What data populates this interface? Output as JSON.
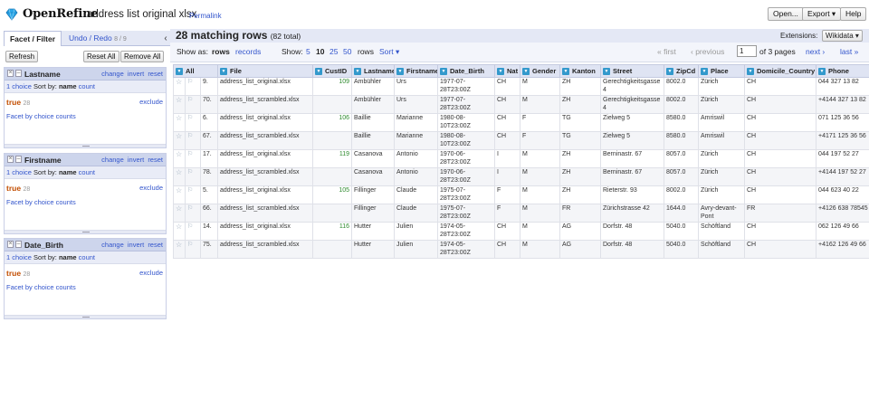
{
  "header": {
    "brand": "OpenRefine",
    "project_name": "address list original xlsx",
    "permalink": "Permalink",
    "open_label": "Open...",
    "export_label": "Export ▾",
    "help_label": "Help"
  },
  "left": {
    "tab_facet": "Facet / Filter",
    "tab_undo": "Undo / Redo",
    "undo_count": "8 / 9",
    "refresh": "Refresh",
    "reset_all": "Reset All",
    "remove_all": "Remove All",
    "facets": [
      {
        "name": "Lastname",
        "change": "change",
        "invert": "invert",
        "reset": "reset",
        "choices": "1 choice",
        "sort_by": "Sort by:",
        "sort_name": "name",
        "sort_count": "count",
        "value": "true",
        "count": "28",
        "exclude": "exclude",
        "by_counts": "Facet by choice counts"
      },
      {
        "name": "Firstname",
        "change": "change",
        "invert": "invert",
        "reset": "reset",
        "choices": "1 choice",
        "sort_by": "Sort by:",
        "sort_name": "name",
        "sort_count": "count",
        "value": "true",
        "count": "28",
        "exclude": "exclude",
        "by_counts": "Facet by choice counts"
      },
      {
        "name": "Date_Birth",
        "change": "change",
        "invert": "invert",
        "reset": "reset",
        "choices": "1 choice",
        "sort_by": "Sort by:",
        "sort_name": "name",
        "sort_count": "count",
        "value": "true",
        "count": "28",
        "exclude": "exclude",
        "by_counts": "Facet by choice counts"
      }
    ]
  },
  "summary": {
    "matching": "28 matching rows",
    "total": "(82 total)",
    "extensions_label": "Extensions:",
    "wikidata": "Wikidata ▾"
  },
  "viewbar": {
    "show_as": "Show as:",
    "rows": "rows",
    "records": "records",
    "show": "Show:",
    "n5": "5",
    "n10": "10",
    "n25": "25",
    "n50": "50",
    "rows2": "rows",
    "sort": "Sort ▾",
    "first": "« first",
    "previous": "‹ previous",
    "page": "1",
    "of_pages": "of 3 pages",
    "next": "next ›",
    "last": "last »"
  },
  "table": {
    "columns": [
      "All",
      "File",
      "CustID",
      "Lastname",
      "Firstname",
      "Date_Birth",
      "Nat",
      "Gender",
      "Kanton",
      "Street",
      "ZipCd",
      "Place",
      "Domicile_Country",
      "Phone"
    ],
    "rows": [
      [
        "9.",
        "address_list_original.xlsx",
        "109",
        "Ambühler",
        "Urs",
        "1977-07-28T23:00Z",
        "CH",
        "M",
        "ZH",
        "Gerechtigkeitsgasse 4",
        "8002.0",
        "Zürich",
        "CH",
        "044 327 13 82"
      ],
      [
        "70.",
        "address_list_scrambled.xlsx",
        "",
        "Ambühler",
        "Urs",
        "1977-07-28T23:00Z",
        "CH",
        "M",
        "ZH",
        "Gerechtigkeitsgasse 4",
        "8002.0",
        "Zürich",
        "CH",
        "+4144 327 13 82"
      ],
      [
        "6.",
        "address_list_original.xlsx",
        "106",
        "Baillie",
        "Marianne",
        "1980-08-10T23:00Z",
        "CH",
        "F",
        "TG",
        "Zielweg 5",
        "8580.0",
        "Amriswil",
        "CH",
        "071 125 36 56"
      ],
      [
        "67.",
        "address_list_scrambled.xlsx",
        "",
        "Baillie",
        "Marianne",
        "1980-08-10T23:00Z",
        "CH",
        "F",
        "TG",
        "Zielweg 5",
        "8580.0",
        "Amriswil",
        "CH",
        "+4171 125 36 56"
      ],
      [
        "17.",
        "address_list_original.xlsx",
        "119",
        "Casanova",
        "Antonio",
        "1970-06-28T23:00Z",
        "I",
        "M",
        "ZH",
        "Berninastr. 67",
        "8057.0",
        "Zürich",
        "CH",
        "044 197 52 27"
      ],
      [
        "78.",
        "address_list_scrambled.xlsx",
        "",
        "Casanova",
        "Antonio",
        "1970-06-28T23:00Z",
        "I",
        "M",
        "ZH",
        "Berninastr. 67",
        "8057.0",
        "Zürich",
        "CH",
        "+4144 197 52 27"
      ],
      [
        "5.",
        "address_list_original.xlsx",
        "105",
        "Fillinger",
        "Claude",
        "1975-07-28T23:00Z",
        "F",
        "M",
        "ZH",
        "Rieterstr. 93",
        "8002.0",
        "Zürich",
        "CH",
        "044 623 40 22"
      ],
      [
        "66.",
        "address_list_scrambled.xlsx",
        "",
        "Fillinger",
        "Claude",
        "1975-07-28T23:00Z",
        "F",
        "M",
        "FR",
        "Zürichstrasse 42",
        "1644.0",
        "Avry-devant-Pont",
        "FR",
        "+4126 638 78545"
      ],
      [
        "14.",
        "address_list_original.xlsx",
        "116",
        "Hutter",
        "Julien",
        "1974-05-28T23:00Z",
        "CH",
        "M",
        "AG",
        "Dorfstr. 48",
        "5040.0",
        "Schöftland",
        "CH",
        "062 126 49 66"
      ],
      [
        "75.",
        "address_list_scrambled.xlsx",
        "",
        "Hutter",
        "Julien",
        "1974-05-28T23:00Z",
        "CH",
        "M",
        "AG",
        "Dorfstr. 48",
        "5040.0",
        "Schöftland",
        "CH",
        "+4162 126 49 66"
      ]
    ]
  }
}
